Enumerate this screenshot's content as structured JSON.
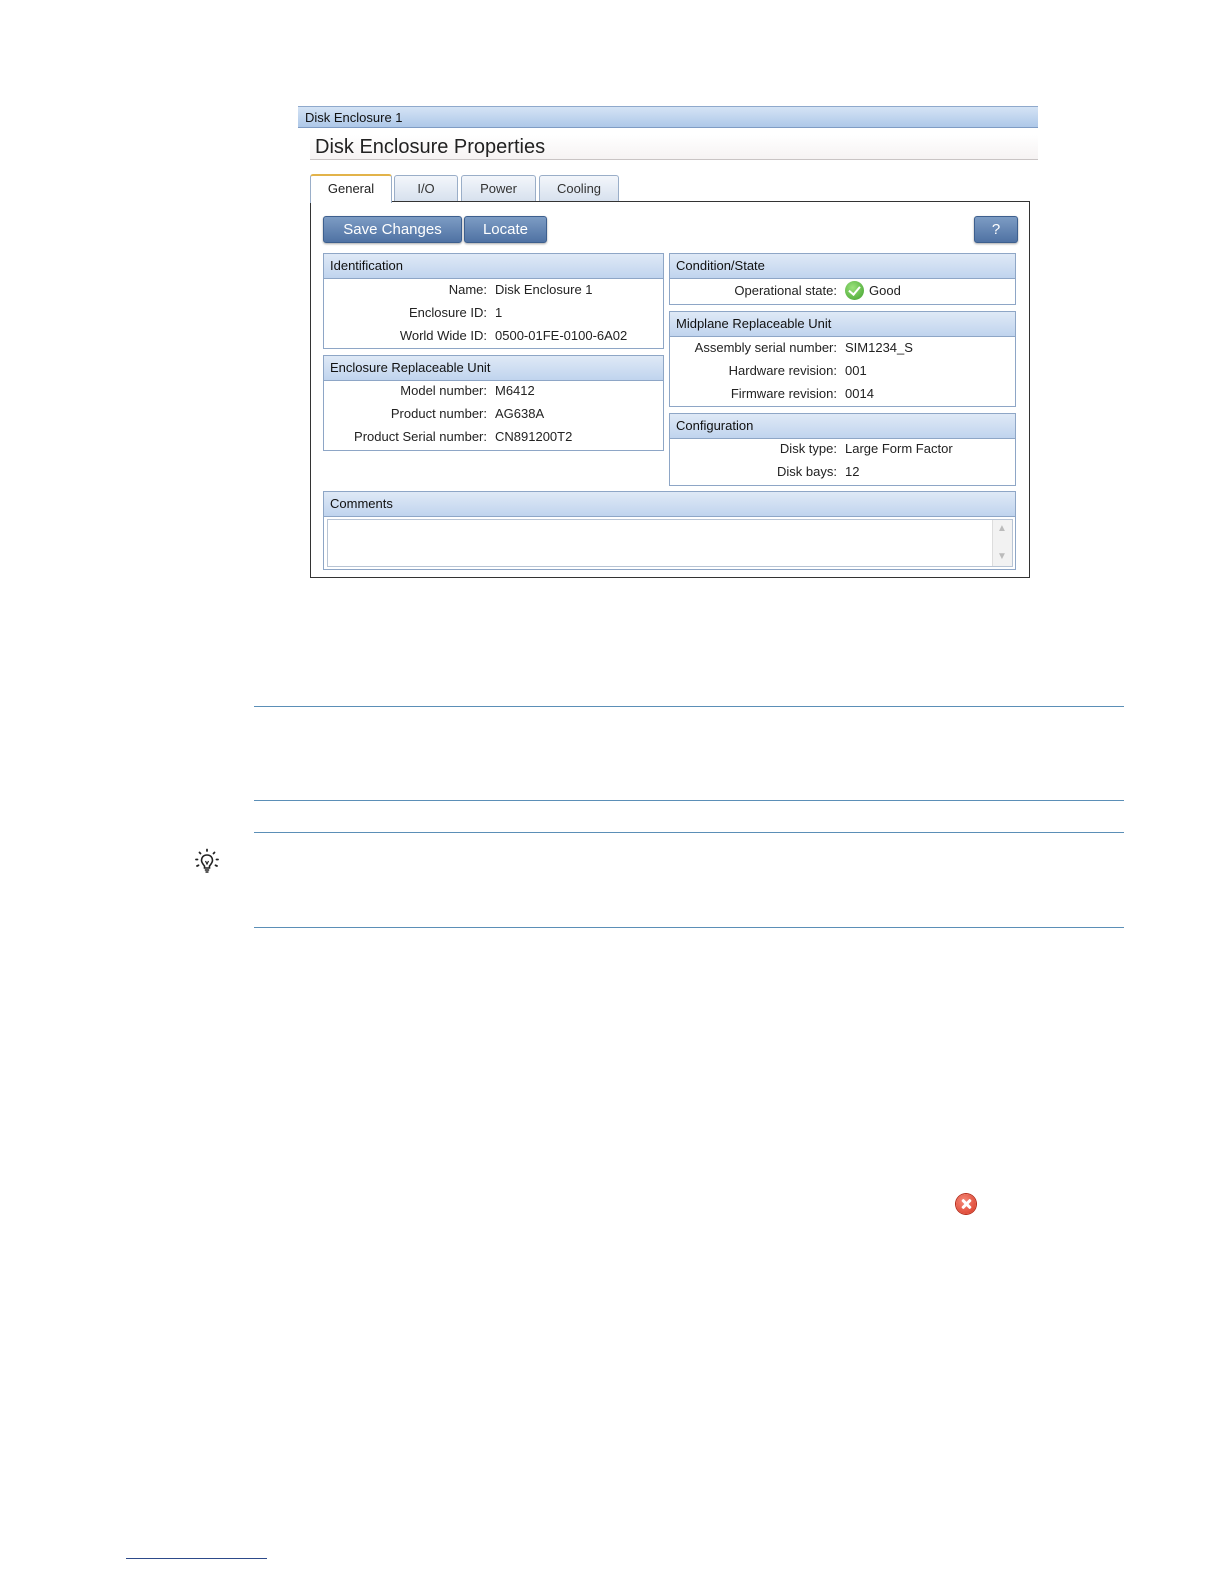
{
  "window": {
    "title": "Disk Enclosure 1"
  },
  "page": {
    "heading": "Disk Enclosure Properties"
  },
  "tabs": [
    {
      "label": "General",
      "active": true
    },
    {
      "label": "I/O",
      "active": false
    },
    {
      "label": "Power",
      "active": false
    },
    {
      "label": "Cooling",
      "active": false
    }
  ],
  "toolbar": {
    "save_label": "Save Changes",
    "locate_label": "Locate",
    "help_label": "?"
  },
  "identification": {
    "title": "Identification",
    "rows": [
      {
        "label": "Name:",
        "value": "Disk Enclosure 1"
      },
      {
        "label": "Enclosure ID:",
        "value": "1"
      },
      {
        "label": "World Wide ID:",
        "value": "0500-01FE-0100-6A02"
      }
    ]
  },
  "enclosure_ru": {
    "title": "Enclosure Replaceable Unit",
    "rows": [
      {
        "label": "Model number:",
        "value": "M6412"
      },
      {
        "label": "Product number:",
        "value": "AG638A"
      },
      {
        "label": "Product Serial number:",
        "value": "CN891200T2"
      }
    ]
  },
  "condition": {
    "title": "Condition/State",
    "rows": [
      {
        "label": "Operational state:",
        "value": "Good",
        "icon": "check-icon"
      }
    ]
  },
  "midplane_ru": {
    "title": "Midplane Replaceable Unit",
    "rows": [
      {
        "label": "Assembly serial number:",
        "value": "SIM1234_S"
      },
      {
        "label": "Hardware revision:",
        "value": "001"
      },
      {
        "label": "Firmware revision:",
        "value": "0014"
      }
    ]
  },
  "configuration": {
    "title": "Configuration",
    "rows": [
      {
        "label": "Disk type:",
        "value": "Large Form Factor"
      },
      {
        "label": "Disk bays:",
        "value": "12"
      }
    ]
  },
  "comments": {
    "title": "Comments",
    "value": ""
  },
  "icons": {
    "tip": "lightbulb-icon",
    "error": "error-icon"
  },
  "colors": {
    "accent": "#4f72a3",
    "good": "#3f9f2b",
    "error": "#d93521",
    "rule": "#5b8fb7"
  }
}
